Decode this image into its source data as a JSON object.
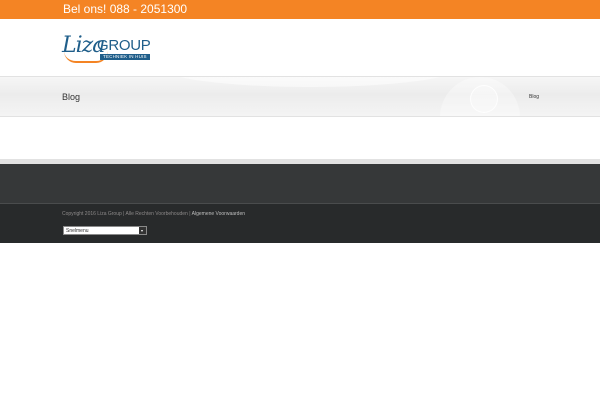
{
  "topbar": {
    "phone_text": "Bel ons! 088 - 2051300",
    "background_color": "#f48424"
  },
  "header": {
    "logo": {
      "brand_name": "Liza",
      "brand_suffix": "GROUP",
      "tagline": "TECHNIEK IN HUIS",
      "brand_color": "#1f5e8a",
      "accent_color": "#f48424"
    }
  },
  "title_bar": {
    "page_title": "Blog",
    "breadcrumb": "Blog"
  },
  "footer": {
    "copyright_text": "Copyright 2016 Liza Group | Alle Rechten Voorbehouden | ",
    "terms_link": "Algemene Voorwaarden",
    "quick_menu": {
      "selected": "Snelmenu"
    }
  }
}
